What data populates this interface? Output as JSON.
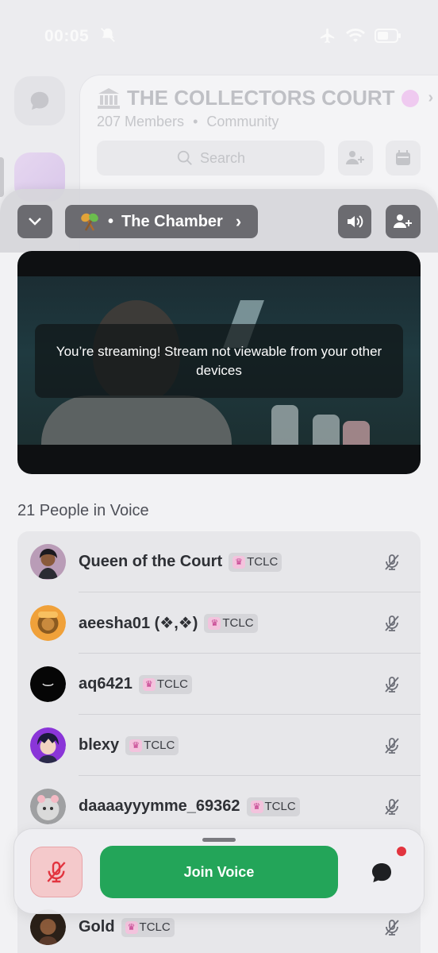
{
  "status_bar": {
    "time": "00:05"
  },
  "server": {
    "name": "THE COLLECTORS COURT",
    "members": "207 Members",
    "type": "Community",
    "separator": "•",
    "search_placeholder": "Search"
  },
  "voice": {
    "channel_prefix": "•",
    "channel_name": "The Chamber",
    "stream_notice": "You’re streaming! Stream not viewable from your other devices",
    "people_heading": "21 People in Voice"
  },
  "members": [
    {
      "name": "Queen of the Court",
      "tag": "TCLC",
      "muted": true
    },
    {
      "name": "aeesha01 (❖,❖)",
      "tag": "TCLC",
      "muted": true
    },
    {
      "name": "aq6421",
      "tag": "TCLC",
      "muted": true
    },
    {
      "name": "blexy",
      "tag": "TCLC",
      "muted": true
    },
    {
      "name": "daaaayyymme_69362",
      "tag": "TCLC",
      "muted": true
    },
    {
      "name": "Gold",
      "tag": "TCLC",
      "muted": true
    }
  ],
  "bottom_bar": {
    "join_label": "Join Voice"
  },
  "colors": {
    "join_green": "#23a559",
    "mute_red": "#e2343f",
    "notification": "#e2343f"
  }
}
